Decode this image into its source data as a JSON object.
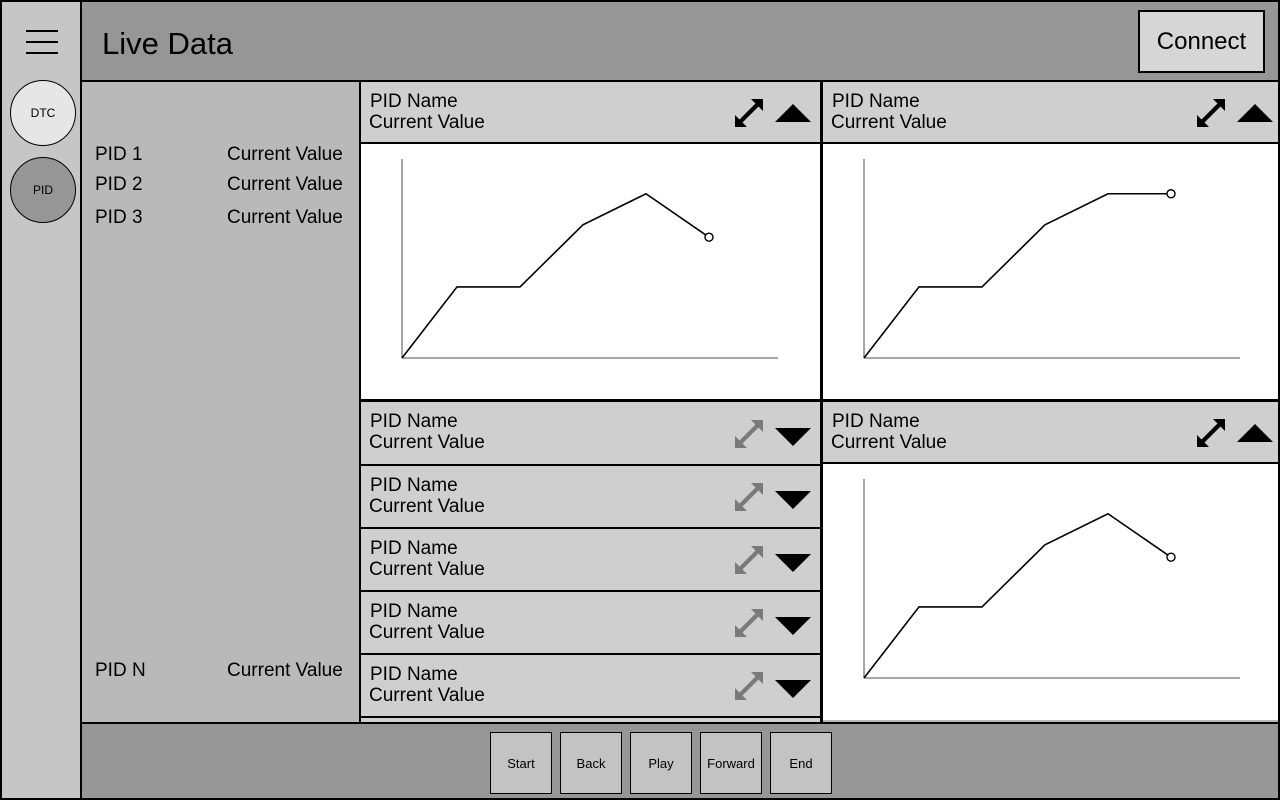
{
  "header": {
    "title": "Live Data",
    "connect_label": "Connect"
  },
  "rail": {
    "dtc_label": "DTC",
    "pid_label": "PID"
  },
  "pid_list": [
    {
      "name": "PID 1",
      "value": "Current Value"
    },
    {
      "name": "PID 2",
      "value": "Current Value"
    },
    {
      "name": "PID 3",
      "value": "Current Value"
    },
    {
      "name": "PID N",
      "value": "Current Value"
    }
  ],
  "panels": [
    {
      "name": "PID Name",
      "value": "Current Value",
      "expanded": true
    },
    {
      "name": "PID Name",
      "value": "Current Value",
      "expanded": true
    },
    {
      "name": "PID Name",
      "value": "Current Value",
      "expanded": true
    },
    {
      "name": "PID Name",
      "value": "Current Value",
      "expanded": false
    },
    {
      "name": "PID Name",
      "value": "Current Value",
      "expanded": false
    },
    {
      "name": "PID Name",
      "value": "Current Value",
      "expanded": false
    },
    {
      "name": "PID Name",
      "value": "Current Value",
      "expanded": false
    },
    {
      "name": "PID Name",
      "value": "Current Value",
      "expanded": false
    }
  ],
  "footer": {
    "start_label": "Start",
    "back_label": "Back",
    "play_label": "Play",
    "forward_label": "Forward",
    "end_label": "End"
  },
  "icons": {
    "menu": "menu-icon",
    "expand": "expand-icon",
    "collapse": "chevron-up-icon",
    "expand_panel": "chevron-down-icon"
  },
  "colors": {
    "header_bg": "#969696",
    "panel_bg": "#b9b9b9",
    "panel_header_bg": "#cfcfcf",
    "disabled_icon": "#7a7a7a"
  },
  "chart_data": [
    {
      "type": "line",
      "x": [
        0,
        1,
        2,
        3,
        4,
        5
      ],
      "y": [
        0,
        2,
        2,
        4,
        5,
        3.6
      ]
    },
    {
      "type": "line",
      "x": [
        0,
        1,
        2,
        3,
        4,
        5
      ],
      "y": [
        0,
        2,
        2,
        4,
        5,
        5
      ]
    },
    {
      "type": "line",
      "x": [
        0,
        1,
        2,
        3,
        4,
        5
      ],
      "y": [
        0,
        2,
        2,
        4,
        5,
        3.6
      ]
    }
  ]
}
